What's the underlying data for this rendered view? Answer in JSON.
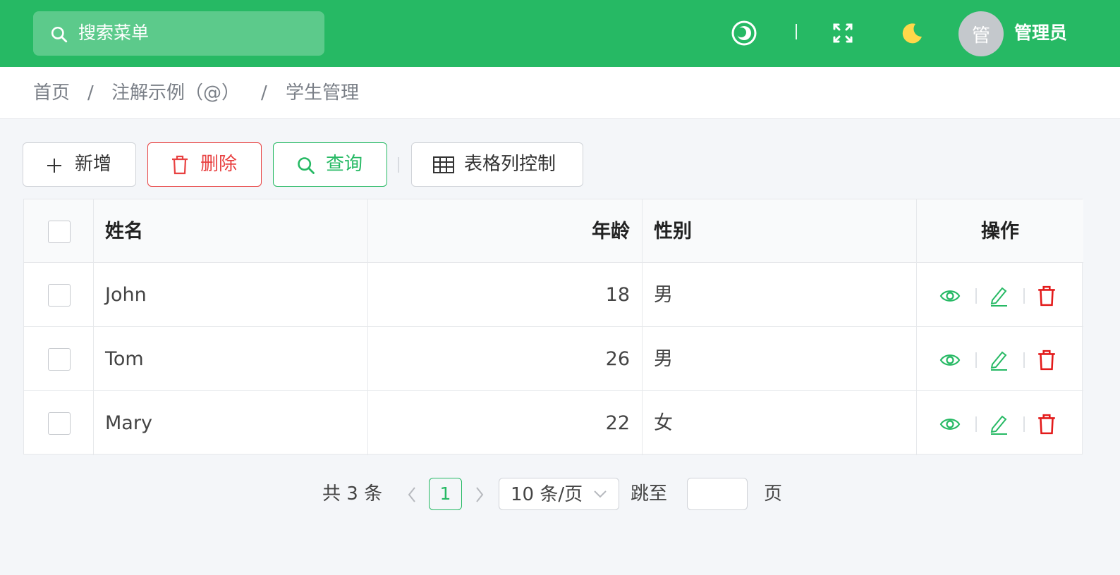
{
  "header": {
    "search_placeholder": "搜索菜单",
    "user_avatar_text": "管",
    "user_name": "管理员"
  },
  "breadcrumb": [
    "首页",
    "注解示例（@）",
    "学生管理"
  ],
  "breadcrumb_separator": "/",
  "toolbar": {
    "add_label": "新增",
    "delete_label": "删除",
    "query_label": "查询",
    "columns_label": "表格列控制"
  },
  "table": {
    "columns": [
      "姓名",
      "年龄",
      "性别",
      "操作"
    ],
    "rows": [
      {
        "name": "John",
        "age": "18",
        "gender": "男"
      },
      {
        "name": "Tom",
        "age": "26",
        "gender": "男"
      },
      {
        "name": "Mary",
        "age": "22",
        "gender": "女"
      }
    ]
  },
  "pagination": {
    "total_text": "共 3 条",
    "current_page": "1",
    "page_size": "10 条/页",
    "jump_label": "跳至",
    "page_suffix": "页"
  },
  "colors": {
    "primary": "#26b964",
    "danger": "#e84141"
  }
}
